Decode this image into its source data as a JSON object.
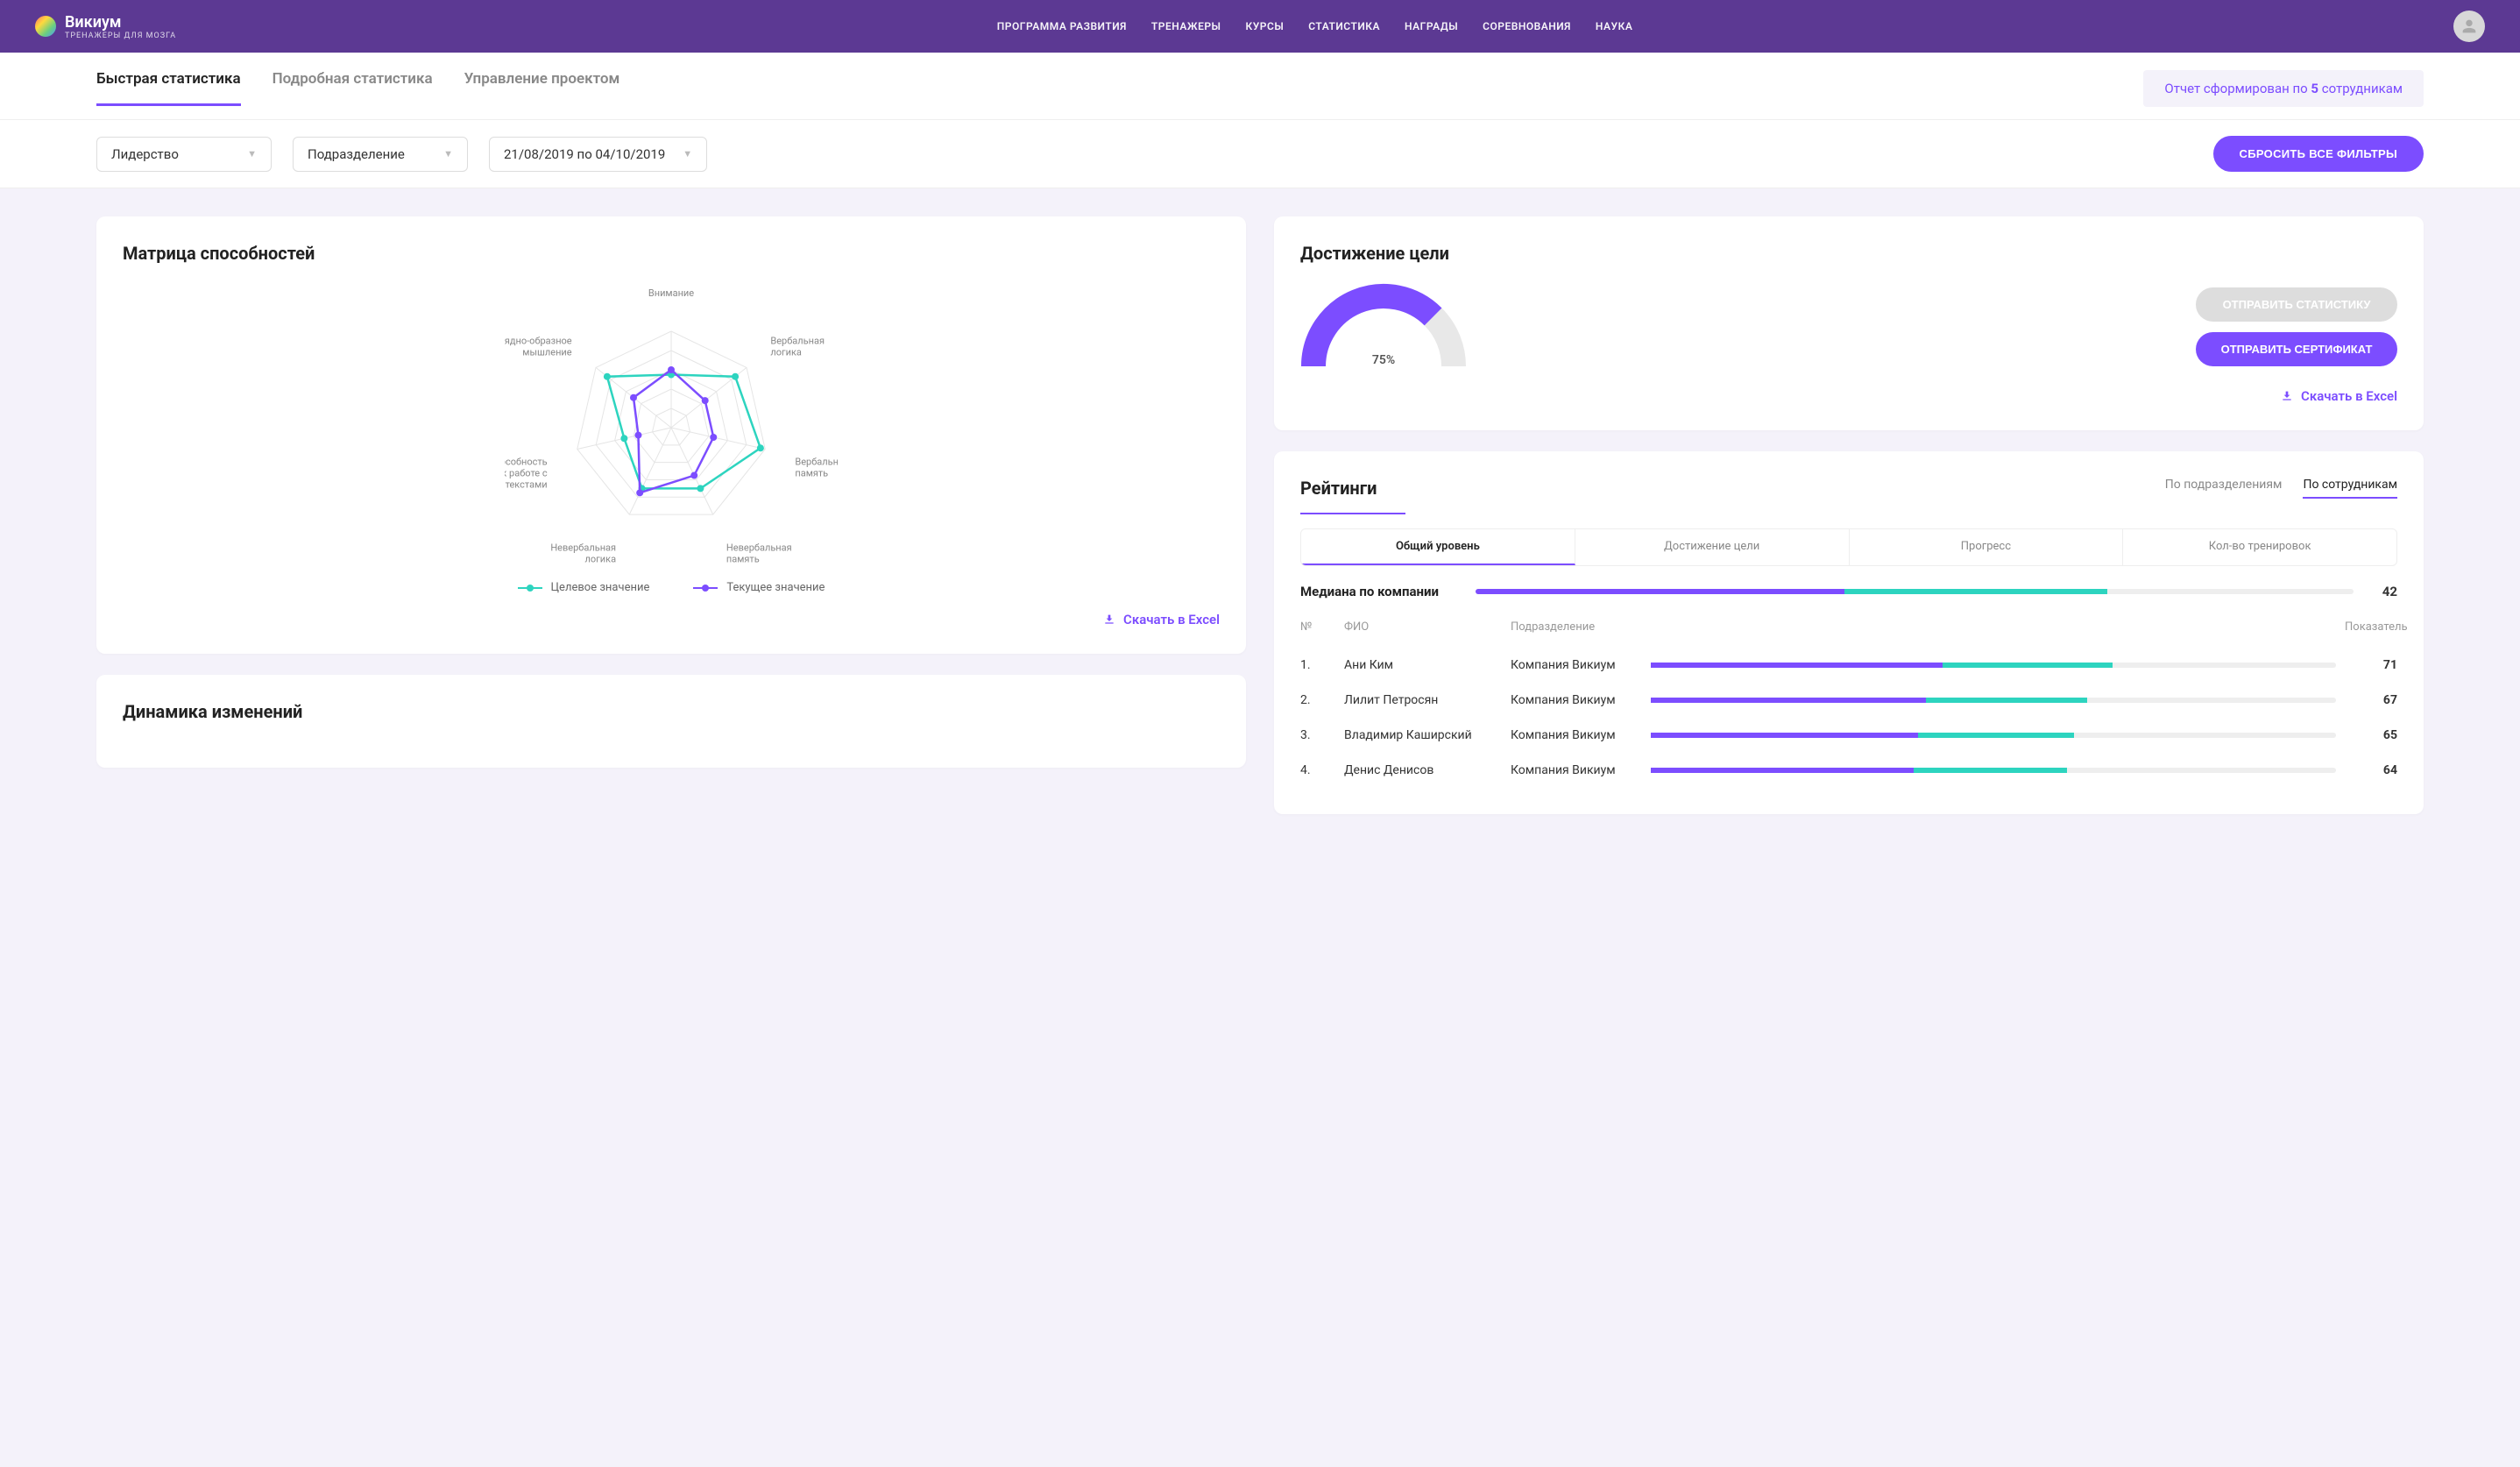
{
  "header": {
    "logo_title": "Викиум",
    "logo_subtitle": "ТРЕНАЖЕРЫ ДЛЯ МОЗГА",
    "nav": [
      "ПРОГРАММА РАЗВИТИЯ",
      "ТРЕНАЖЕРЫ",
      "КУРСЫ",
      "СТАТИСТИКА",
      "НАГРАДЫ",
      "СОРЕВНОВАНИЯ",
      "НАУКА"
    ]
  },
  "tabs": {
    "items": [
      "Быстрая статистика",
      "Подробная статистика",
      "Управление проектом"
    ],
    "active": 0
  },
  "report_banner": {
    "prefix": "Отчет сформирован по ",
    "count": "5",
    "suffix": " сотрудникам"
  },
  "filters": {
    "leadership": "Лидерство",
    "department": "Подразделение",
    "daterange": "21/08/2019 по 04/10/2019",
    "reset": "СБРОСИТЬ ВСЕ ФИЛЬТРЫ"
  },
  "matrix": {
    "title": "Матрица способностей",
    "axes": [
      "Внимание",
      "Вербальная логика",
      "Вербально-логическая память",
      "Невербальная память",
      "Невербальная логика",
      "Способность к работе с текстами",
      "Наглядно-образное мышление"
    ],
    "legend_target": "Целевое значение",
    "legend_current": "Текущее значение",
    "download": "Скачать в Excel"
  },
  "goal": {
    "title": "Достижение цели",
    "value": "75",
    "unit": "%",
    "send_stats": "ОТПРАВИТЬ СТАТИСТИКУ",
    "send_cert": "ОТПРАВИТЬ СЕРТИФИКАТ",
    "download": "Скачать в Excel"
  },
  "dynamics": {
    "title": "Динамика изменений"
  },
  "ratings": {
    "title": "Рейтинги",
    "top_tabs": [
      "По подразделениям",
      "По сотрудникам"
    ],
    "top_active": 1,
    "sub_tabs": [
      "Общий уровень",
      "Достижение цели",
      "Прогресс",
      "Кол-во тренировок"
    ],
    "sub_active": 0,
    "median_label": "Медиана по компании",
    "median_value": "42",
    "columns": [
      "№",
      "ФИО",
      "Подразделение",
      "Показатель"
    ],
    "rows": [
      {
        "n": "1.",
        "name": "Ани Ким",
        "dept": "Компания Викиум",
        "val": "71"
      },
      {
        "n": "2.",
        "name": "Лилит Петросян",
        "dept": "Компания Викиум",
        "val": "67"
      },
      {
        "n": "3.",
        "name": "Владимир Каширский",
        "dept": "Компания Викиум",
        "val": "65"
      },
      {
        "n": "4.",
        "name": "Денис Денисов",
        "dept": "Компания Викиум",
        "val": "64"
      }
    ]
  },
  "chart_data": {
    "radar": {
      "type": "radar",
      "axes": [
        "Внимание",
        "Вербальная логика",
        "Вербально-логическая память",
        "Невербальная память",
        "Невербальная логика",
        "Способность к работе с текстами",
        "Наглядно-образное мышление"
      ],
      "range": [
        0,
        100
      ],
      "series": [
        {
          "name": "Целевое значение",
          "color": "#2dd4bf",
          "values": [
            55,
            85,
            95,
            70,
            70,
            50,
            85
          ]
        },
        {
          "name": "Текущее значение",
          "color": "#7c4dff",
          "values": [
            60,
            45,
            45,
            55,
            75,
            35,
            50
          ]
        }
      ]
    },
    "gauge": {
      "type": "gauge",
      "value": 75,
      "range": [
        0,
        100
      ],
      "color": "#7c4dff"
    }
  }
}
